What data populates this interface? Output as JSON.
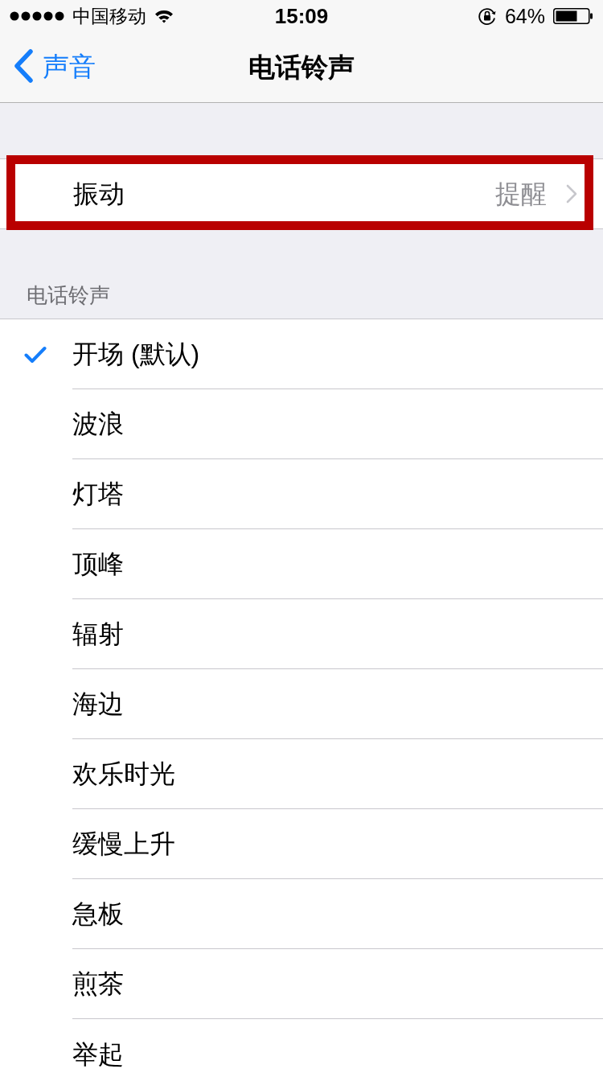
{
  "status_bar": {
    "carrier": "中国移动",
    "time": "15:09",
    "battery": "64%"
  },
  "nav_bar": {
    "back_label": "声音",
    "title": "电话铃声"
  },
  "vibration_row": {
    "label": "振动",
    "value": "提醒",
    "highlighted": true
  },
  "ringtones": {
    "header": "电话铃声",
    "items": [
      {
        "label": "开场 (默认)",
        "selected": true
      },
      {
        "label": "波浪",
        "selected": false
      },
      {
        "label": "灯塔",
        "selected": false
      },
      {
        "label": "顶峰",
        "selected": false
      },
      {
        "label": "辐射",
        "selected": false
      },
      {
        "label": "海边",
        "selected": false
      },
      {
        "label": "欢乐时光",
        "selected": false
      },
      {
        "label": "缓慢上升",
        "selected": false
      },
      {
        "label": "急板",
        "selected": false
      },
      {
        "label": "煎茶",
        "selected": false
      },
      {
        "label": "举起",
        "selected": false
      }
    ]
  }
}
